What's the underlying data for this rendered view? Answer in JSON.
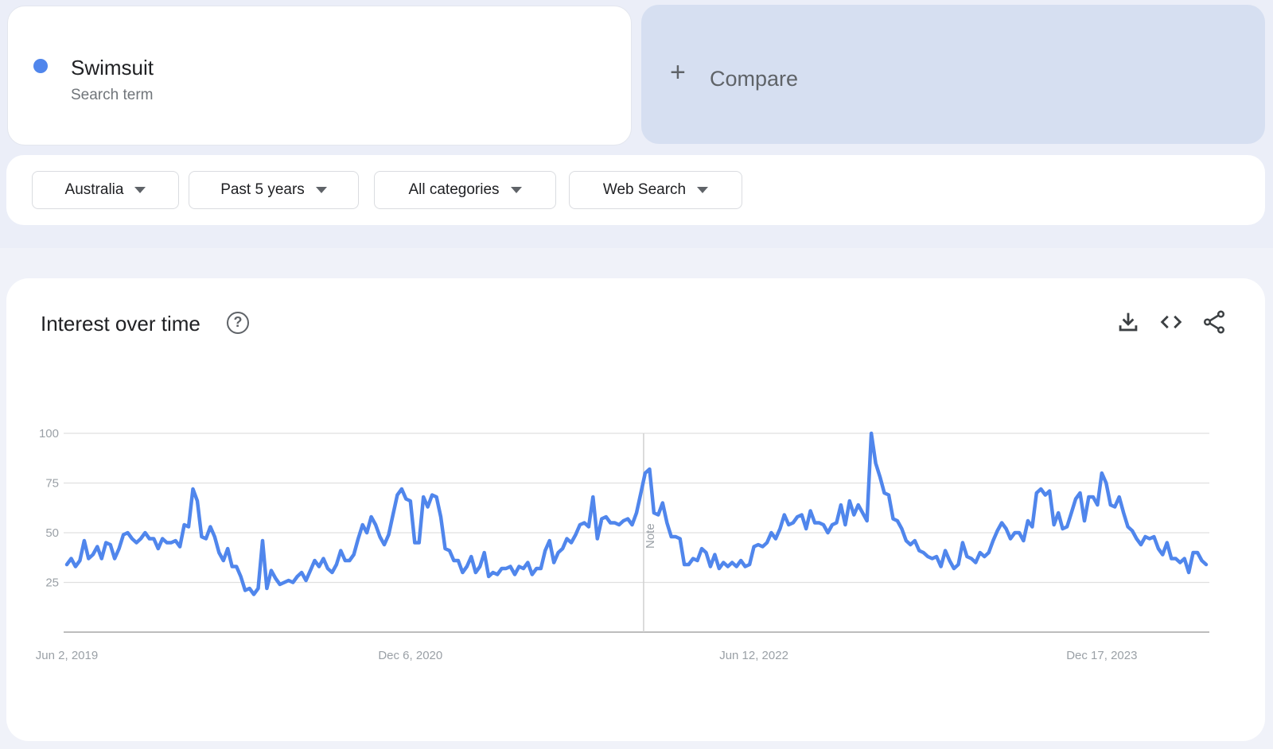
{
  "search_term": {
    "name": "Swimsuit",
    "subtitle": "Search term",
    "color": "#5086ec"
  },
  "compare": {
    "icon": "plus-icon",
    "label": "Compare"
  },
  "filters": [
    {
      "label": "Australia"
    },
    {
      "label": "Past 5 years"
    },
    {
      "label": "All categories"
    },
    {
      "label": "Web Search"
    }
  ],
  "panel": {
    "title": "Interest over time",
    "help_icon": "?",
    "tools": [
      "download-icon",
      "embed-code-icon",
      "share-icon"
    ]
  },
  "chart_data": {
    "type": "line",
    "title": "Interest over time",
    "xlabel": "",
    "ylabel": "",
    "ylim": [
      0,
      100
    ],
    "yticks": [
      25,
      50,
      75,
      100
    ],
    "xtick_labels": [
      "Jun 2, 2019",
      "Dec 6, 2020",
      "Jun 12, 2022",
      "Dec 17, 2023"
    ],
    "x_start": "Jun 2, 2019",
    "interval": "weekly",
    "grid": true,
    "legend": "none",
    "annotation": {
      "label": "Note",
      "x_index": 133
    },
    "series": [
      {
        "name": "Swimsuit",
        "color": "#5086ec",
        "values": [
          34,
          37,
          33,
          36,
          46,
          37,
          39,
          43,
          37,
          45,
          44,
          37,
          42,
          49,
          50,
          47,
          45,
          47,
          50,
          47,
          47,
          42,
          47,
          45,
          45,
          46,
          43,
          54,
          53,
          72,
          66,
          48,
          47,
          53,
          48,
          40,
          36,
          42,
          33,
          33,
          28,
          21,
          22,
          19,
          22,
          46,
          22,
          31,
          27,
          24,
          25,
          26,
          25,
          28,
          30,
          26,
          31,
          36,
          33,
          37,
          32,
          30,
          34,
          41,
          36,
          36,
          39,
          47,
          54,
          50,
          58,
          54,
          48,
          44,
          49,
          59,
          69,
          72,
          67,
          66,
          45,
          45,
          68,
          63,
          69,
          68,
          58,
          42,
          41,
          36,
          36,
          30,
          33,
          38,
          30,
          33,
          40,
          28,
          30,
          29,
          32,
          32,
          33,
          29,
          33,
          32,
          35,
          29,
          32,
          32,
          41,
          46,
          35,
          40,
          42,
          47,
          45,
          49,
          54,
          55,
          53,
          68,
          47,
          57,
          58,
          55,
          55,
          54,
          56,
          57,
          54,
          60,
          70,
          80,
          82,
          60,
          59,
          65,
          55,
          48,
          48,
          47,
          34,
          34,
          37,
          36,
          42,
          40,
          33,
          39,
          32,
          35,
          33,
          35,
          33,
          36,
          33,
          34,
          43,
          44,
          43,
          45,
          50,
          47,
          52,
          59,
          54,
          55,
          58,
          59,
          52,
          61,
          55,
          55,
          54,
          50,
          54,
          55,
          64,
          54,
          66,
          59,
          64,
          60,
          56,
          100,
          85,
          78,
          70,
          69,
          57,
          56,
          52,
          46,
          44,
          46,
          41,
          40,
          38,
          37,
          38,
          33,
          41,
          36,
          32,
          34,
          45,
          38,
          37,
          35,
          40,
          38,
          40,
          46,
          51,
          55,
          52,
          47,
          50,
          50,
          46,
          56,
          53,
          70,
          72,
          69,
          71,
          54,
          60,
          52,
          53,
          60,
          67,
          70,
          56,
          68,
          68,
          64,
          80,
          75,
          64,
          63,
          68,
          60,
          53,
          51,
          47,
          44,
          48,
          47,
          48,
          42,
          39,
          45,
          37,
          37,
          35,
          37,
          30,
          40,
          40,
          36,
          34
        ]
      }
    ]
  }
}
